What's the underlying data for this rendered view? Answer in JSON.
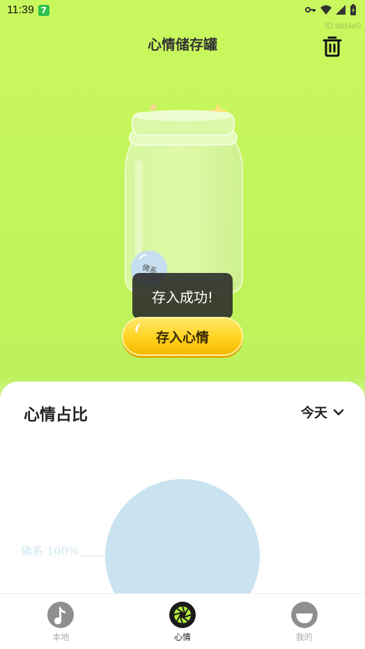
{
  "status_bar": {
    "time": "11:39",
    "app_badge": "7"
  },
  "watermark": "ID:afd4e0",
  "header": {
    "title": "心情储存罐"
  },
  "jar": {
    "ball_label": "佛系"
  },
  "toast": {
    "message": "存入成功!"
  },
  "store_button": {
    "label": "存入心情"
  },
  "panel": {
    "title": "心情占比",
    "period": "今天"
  },
  "chart_data": {
    "type": "pie",
    "slices": [
      {
        "label": "佛系",
        "value": 100,
        "color": "#c9e3f0"
      }
    ],
    "legend_text": "佛系 100%"
  },
  "bottom_nav": {
    "items": [
      {
        "label": "本地",
        "icon": "music-note-icon",
        "active": false
      },
      {
        "label": "心情",
        "icon": "aperture-icon",
        "active": true
      },
      {
        "label": "我的",
        "icon": "smile-icon",
        "active": false
      }
    ]
  }
}
